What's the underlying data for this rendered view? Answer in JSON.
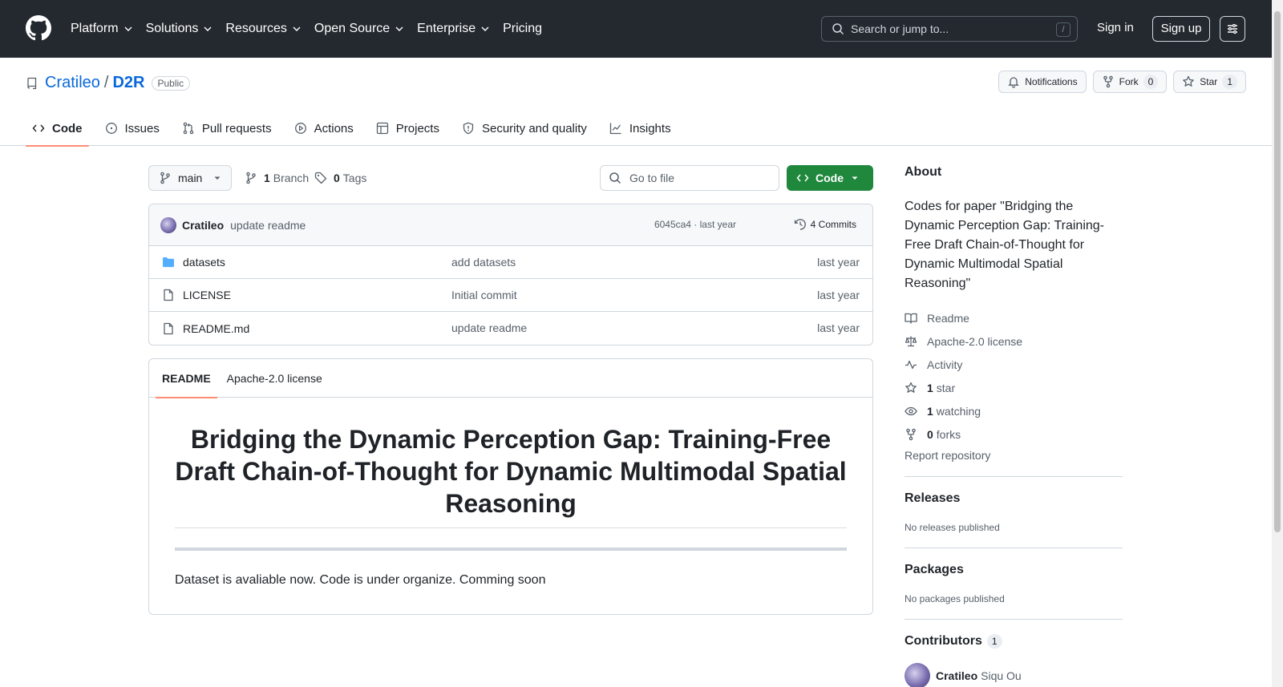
{
  "topnav": {
    "items": [
      {
        "label": "Platform",
        "has_menu": true
      },
      {
        "label": "Solutions",
        "has_menu": true
      },
      {
        "label": "Resources",
        "has_menu": true
      },
      {
        "label": "Open Source",
        "has_menu": true
      },
      {
        "label": "Enterprise",
        "has_menu": true
      },
      {
        "label": "Pricing",
        "has_menu": false
      }
    ],
    "search_placeholder": "Search or jump to...",
    "search_shortcut": "/",
    "sign_in": "Sign in",
    "sign_up": "Sign up"
  },
  "repo": {
    "owner": "Cratileo",
    "separator": "/",
    "name": "D2R",
    "visibility": "Public",
    "notifications_label": "Notifications",
    "fork_label": "Fork",
    "fork_count": "0",
    "star_label": "Star",
    "star_count": "1"
  },
  "tabs": [
    {
      "label": "Code",
      "icon": "code-icon",
      "active": true
    },
    {
      "label": "Issues",
      "icon": "issue-icon",
      "active": false
    },
    {
      "label": "Pull requests",
      "icon": "pull-request-icon",
      "active": false
    },
    {
      "label": "Actions",
      "icon": "play-icon",
      "active": false
    },
    {
      "label": "Projects",
      "icon": "table-icon",
      "active": false
    },
    {
      "label": "Security and quality",
      "icon": "shield-icon",
      "active": false
    },
    {
      "label": "Insights",
      "icon": "graph-icon",
      "active": false
    }
  ],
  "toolbar": {
    "branch": "main",
    "branch_count": "1",
    "branch_label": "Branch",
    "tag_count": "0",
    "tag_label": "Tags",
    "goto_file_placeholder": "Go to file",
    "code_button": "Code"
  },
  "commit": {
    "author": "Cratileo",
    "message": "update readme",
    "meta": "6045ca4 · last year",
    "commits_label": "4 Commits"
  },
  "files": [
    {
      "type": "folder",
      "name": "datasets",
      "commit": "add datasets",
      "date": "last year"
    },
    {
      "type": "file",
      "name": "LICENSE",
      "commit": "Initial commit",
      "date": "last year"
    },
    {
      "type": "file",
      "name": "README.md",
      "commit": "update readme",
      "date": "last year"
    }
  ],
  "readme": {
    "tab_readme": "README",
    "tab_license": "Apache-2.0 license",
    "title": "Bridging the Dynamic Perception Gap: Training-Free Draft Chain-of-Thought for Dynamic Multimodal Spatial Reasoning",
    "body": "Dataset is avaliable now. Code is under organize. Comming soon"
  },
  "about": {
    "heading": "About",
    "description": "Codes for paper \"Bridging the Dynamic Perception Gap: Training-Free Draft Chain-of-Thought for Dynamic Multimodal Spatial Reasoning\"",
    "readme": "Readme",
    "license": "Apache-2.0 license",
    "activity": "Activity",
    "stars_count": "1",
    "stars_label": "star",
    "watching_count": "1",
    "watching_label": "watching",
    "forks_count": "0",
    "forks_label": "forks",
    "report": "Report repository"
  },
  "releases": {
    "heading": "Releases",
    "empty": "No releases published"
  },
  "packages": {
    "heading": "Packages",
    "empty": "No packages published"
  },
  "contributors": {
    "heading": "Contributors",
    "count": "1",
    "login": "Cratileo",
    "full_name": "Siqu Ou"
  },
  "colors": {
    "accent_link": "#0969da",
    "code_button": "#1f883d",
    "active_tab": "#fd8c73",
    "nav_bg": "#24292f"
  }
}
